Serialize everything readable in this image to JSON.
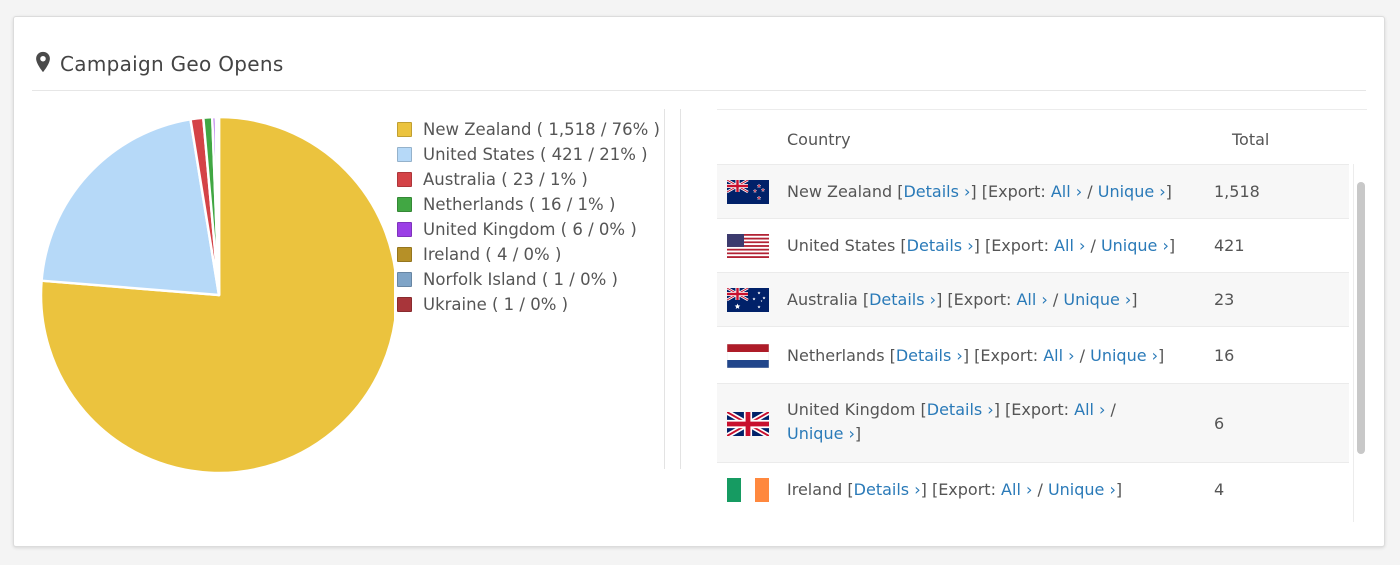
{
  "header": {
    "title": "Campaign Geo Opens",
    "icon": "map-pin-icon"
  },
  "chart_data": {
    "type": "pie",
    "title": "",
    "categories": [
      "New Zealand",
      "United States",
      "Australia",
      "Netherlands",
      "United Kingdom",
      "Ireland",
      "Norfolk Island",
      "Ukraine"
    ],
    "values": [
      1518,
      421,
      23,
      16,
      6,
      4,
      1,
      1
    ],
    "colors": [
      "#ebc33e",
      "#b6d9f8",
      "#d44347",
      "#41a743",
      "#9b3fe6",
      "#b69027",
      "#7fa4c7",
      "#a8353a"
    ],
    "legend_position": "right",
    "legend_labels": [
      "New Zealand ( 1,518 / 76% )",
      "United States ( 421 / 21% )",
      "Australia ( 23 / 1% )",
      "Netherlands ( 16 / 1% )",
      "United Kingdom ( 6 / 0% )",
      "Ireland ( 4 / 0% )",
      "Norfolk Island ( 1 / 0% )",
      "Ukraine ( 1 / 0% )"
    ]
  },
  "table": {
    "headers": {
      "country": "Country",
      "total": "Total"
    },
    "rows": [
      {
        "flag": "new-zealand-flag",
        "name": "New Zealand",
        "total": "1,518"
      },
      {
        "flag": "united-states-flag",
        "name": "United States",
        "total": "421"
      },
      {
        "flag": "australia-flag",
        "name": "Australia",
        "total": "23"
      },
      {
        "flag": "netherlands-flag",
        "name": "Netherlands",
        "total": "16"
      },
      {
        "flag": "united-kingdom-flag",
        "name": "United Kingdom",
        "total": "6"
      },
      {
        "flag": "ireland-flag",
        "name": "Ireland",
        "total": "4"
      }
    ],
    "text": {
      "open_bracket": " [",
      "details": "Details ›",
      "mid": "] [Export: ",
      "all": "All ›",
      "slash": " / ",
      "unique": "Unique ›",
      "close": "]"
    }
  }
}
